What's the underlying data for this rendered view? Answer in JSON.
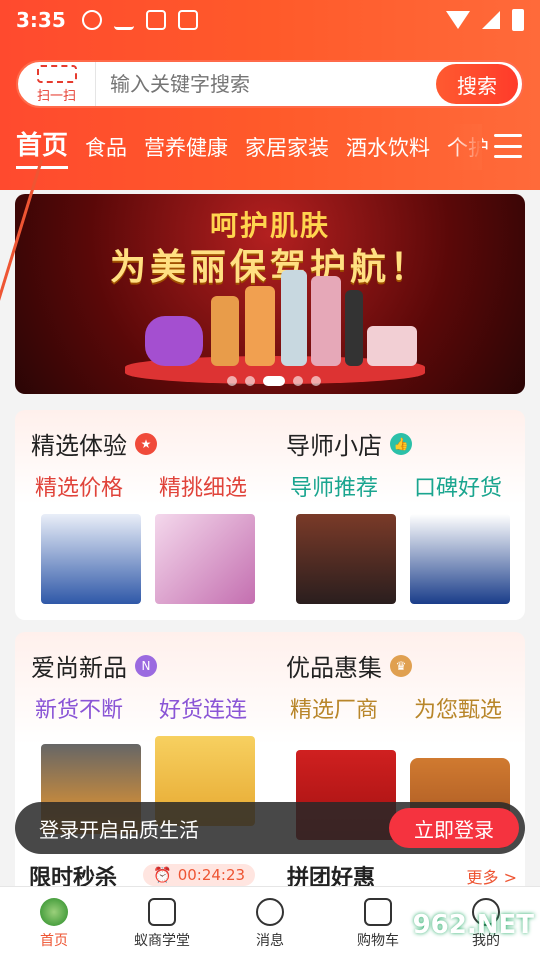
{
  "status": {
    "time": "3:35"
  },
  "search": {
    "scan_label": "扫一扫",
    "placeholder": "输入关键字搜索",
    "button": "搜索"
  },
  "tabs": [
    "首页",
    "食品",
    "营养健康",
    "家居家装",
    "酒水饮料",
    "个护"
  ],
  "banner": {
    "line1": "呵护肌肤",
    "line2": "为美丽保驾护航！"
  },
  "sections": {
    "jingxuan": {
      "title": "精选体验",
      "sub_a": "精选价格",
      "sub_b": "精挑细选"
    },
    "daoshi": {
      "title": "导师小店",
      "sub_a": "导师推荐",
      "sub_b": "口碑好货"
    },
    "aishang": {
      "title": "爱尚新品",
      "sub_a": "新货不断",
      "sub_b": "好货连连"
    },
    "youpin": {
      "title": "优品惠集",
      "sub_a": "精选厂商",
      "sub_b": "为您甄选"
    }
  },
  "toast": {
    "message": "登录开启品质生活",
    "button": "立即登录"
  },
  "bottom_row": {
    "left_title": "限时秒杀",
    "timer": "00:24:23",
    "right_title": "拼团好惠",
    "more": "更多 >"
  },
  "nav": [
    "首页",
    "蚁商学堂",
    "消息",
    "购物车",
    "我的"
  ],
  "watermark": "962.NET",
  "colors": {
    "accent": "#ff4a2e",
    "button_red": "#f5333f"
  }
}
